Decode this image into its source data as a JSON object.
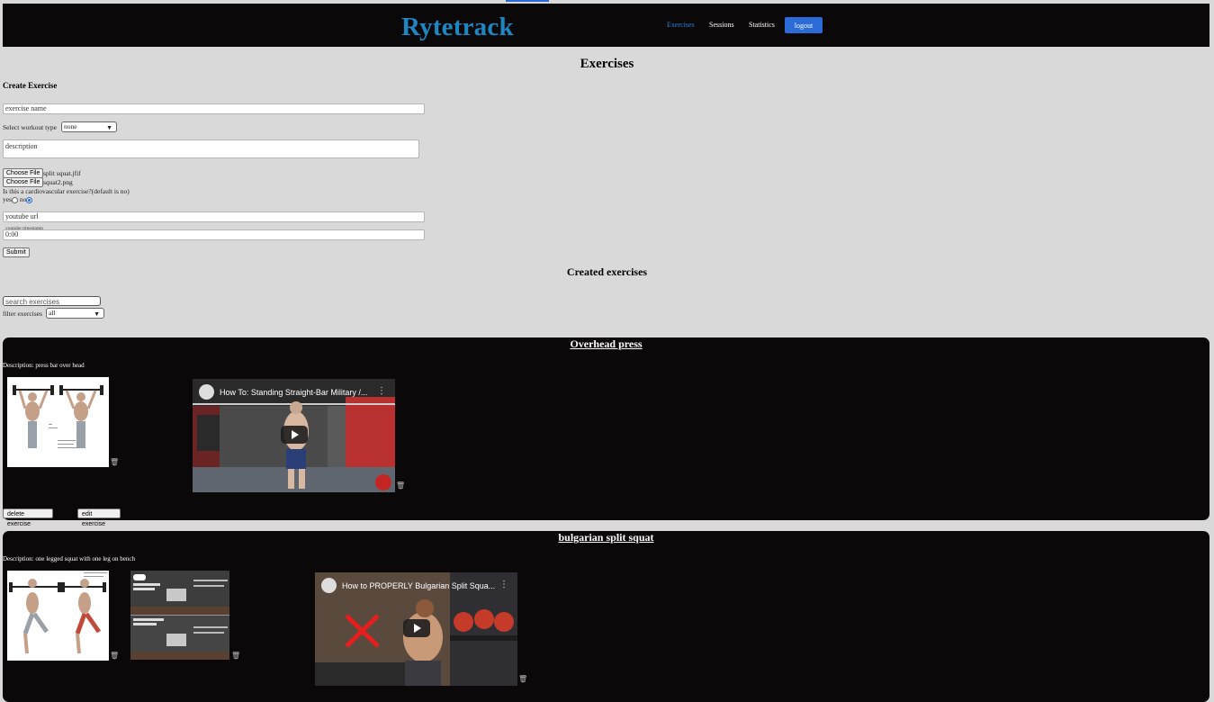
{
  "header": {
    "brand": "Rytetrack",
    "nav": {
      "exercises": "Exercises",
      "sessions": "Sessions",
      "statistics": "Statistics"
    },
    "logout": "logout"
  },
  "page": {
    "title": "Exercises"
  },
  "create_form": {
    "title": "Create Exercise",
    "name_placeholder": "exercise name",
    "workout_type_label": "Select workout type",
    "workout_type_value": "none",
    "description_placeholder": "description",
    "file_button": "Choose File",
    "file1": "split squat.jfif",
    "file2": "squat2.png",
    "cardio_question": "Is this a cardiovascular exercise?(default is no)",
    "yes_label": "yes",
    "no_label": "no",
    "youtube_placeholder": "youtube url",
    "timestamp_label": "youtube timestamp",
    "timestamp_value": "0:00",
    "submit": "Submit"
  },
  "created": {
    "title": "Created exercises",
    "search_placeholder": "search exercises",
    "filter_label": "filter exercises",
    "filter_value": "all"
  },
  "exercises": [
    {
      "title": "Overhead press",
      "description": "Description: press bar over head",
      "video_title": "How To: Standing Straight-Bar Military /...",
      "delete": "delete exercise",
      "edit": "edit exercise"
    },
    {
      "title": "bulgarian split squat",
      "description": "Description: one legged squat with one leg on bench",
      "video_title": "How to PROPERLY Bulgarian Split Squa..."
    }
  ],
  "icons": [
    "trash-icon",
    "play-icon",
    "chevron-down-icon",
    "more-vert-icon"
  ],
  "colors": {
    "brand": "#1f86c4",
    "accent": "#2a6bd8",
    "card_bg": "#0b0809",
    "page_bg": "#d9d9d9"
  }
}
